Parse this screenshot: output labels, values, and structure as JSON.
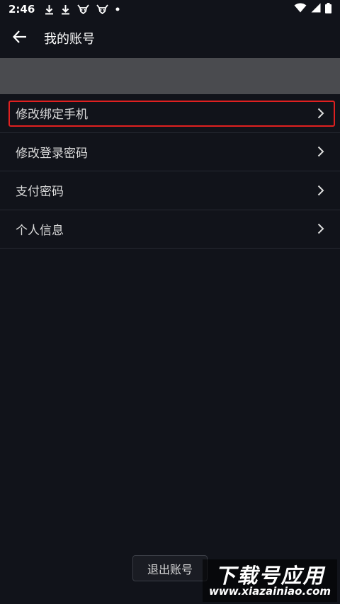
{
  "status_bar": {
    "time": "2:46",
    "icons_left": [
      "download-icon",
      "download-icon",
      "ox-icon",
      "ox-icon",
      "dot-icon"
    ],
    "icons_right": [
      "wifi-icon",
      "signal-icon",
      "battery-icon"
    ]
  },
  "app_bar": {
    "title": "我的账号",
    "back_icon": "arrow-left-icon"
  },
  "menu": {
    "items": [
      {
        "label": "修改绑定手机",
        "highlighted": true
      },
      {
        "label": "修改登录密码",
        "highlighted": false
      },
      {
        "label": "支付密码",
        "highlighted": false
      },
      {
        "label": "个人信息",
        "highlighted": false
      }
    ]
  },
  "logout": {
    "label": "退出账号"
  },
  "watermark": {
    "title": "下载号应用",
    "url": "www.xiazainiao.com"
  },
  "colors": {
    "background": "#11131a",
    "band": "#4a4b4f",
    "highlight": "#e02020",
    "divider": "#262932"
  }
}
